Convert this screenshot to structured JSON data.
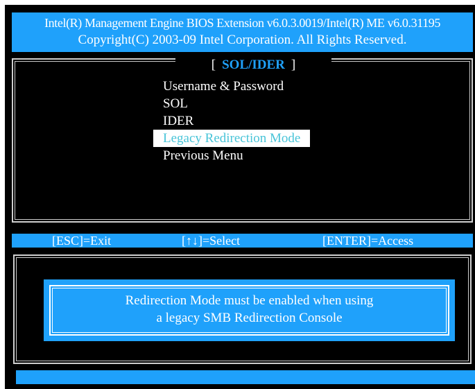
{
  "header": {
    "line1": "Intel(R) Management Engine BIOS Extension v6.0.3.0019/Intel(R) ME v6.0.31195",
    "line2": "Copyright(C) 2003-09 Intel Corporation. All Rights Reserved."
  },
  "menu": {
    "bracket_open": "[",
    "title": "SOL/IDER",
    "bracket_close": "]",
    "items": [
      {
        "label": "Username & Password"
      },
      {
        "label": "SOL"
      },
      {
        "label": "IDER"
      },
      {
        "label": "Legacy Redirection Mode",
        "selected": true
      },
      {
        "label": "Previous Menu"
      }
    ]
  },
  "status_bar": {
    "exit": "[ESC]=Exit",
    "select": "[↑↓]=Select",
    "access": "[ENTER]=Access"
  },
  "message": {
    "line1": "Redirection Mode must be enabled when using",
    "line2": "a legacy SMB Redirection Console"
  },
  "colors": {
    "accent": "#1fa1fb",
    "background": "#000000",
    "text": "#ffffff",
    "selected_text": "#48c4d8",
    "frame": "#cfcfcf"
  }
}
